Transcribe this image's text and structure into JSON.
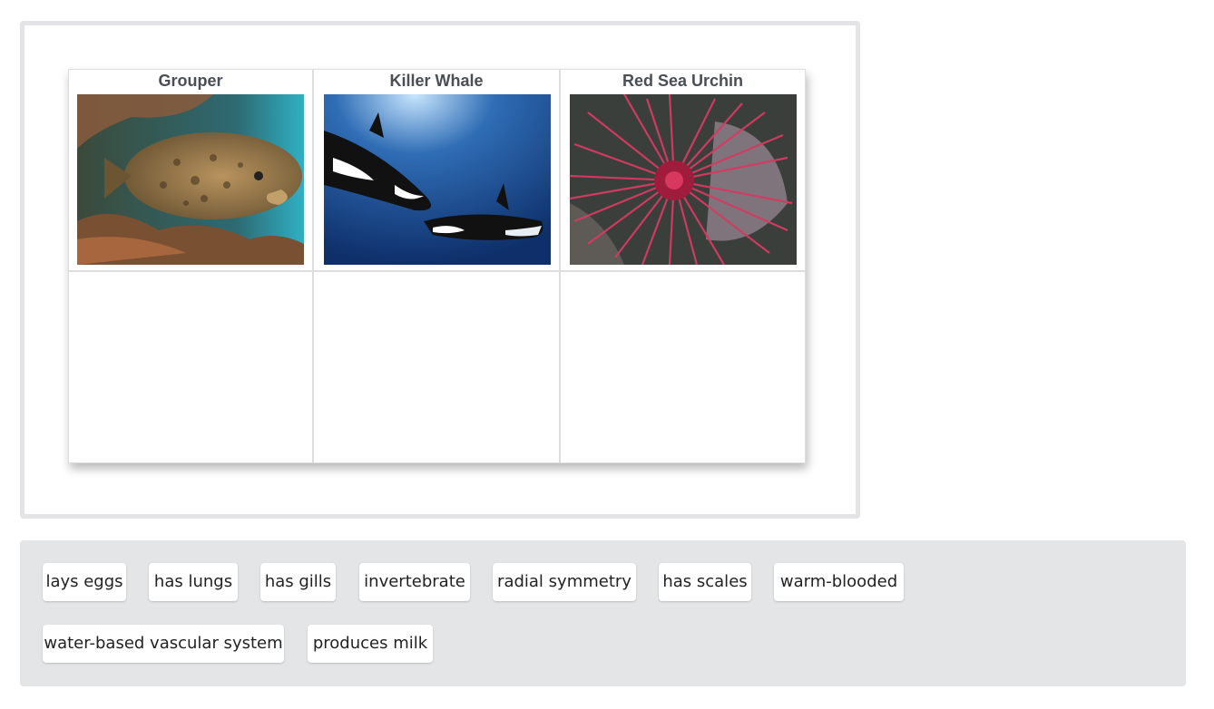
{
  "board": {
    "columns": [
      {
        "title": "Grouper",
        "image_alt": "grouper-photo"
      },
      {
        "title": "Killer Whale",
        "image_alt": "killer-whale-photo"
      },
      {
        "title": "Red Sea Urchin",
        "image_alt": "red-sea-urchin-photo"
      }
    ]
  },
  "bank": {
    "chips": [
      "lays eggs",
      "has lungs",
      "has gills",
      "invertebrate",
      "radial symmetry",
      "has scales",
      "warm-blooded",
      "water-based vascular system",
      "produces milk"
    ]
  }
}
